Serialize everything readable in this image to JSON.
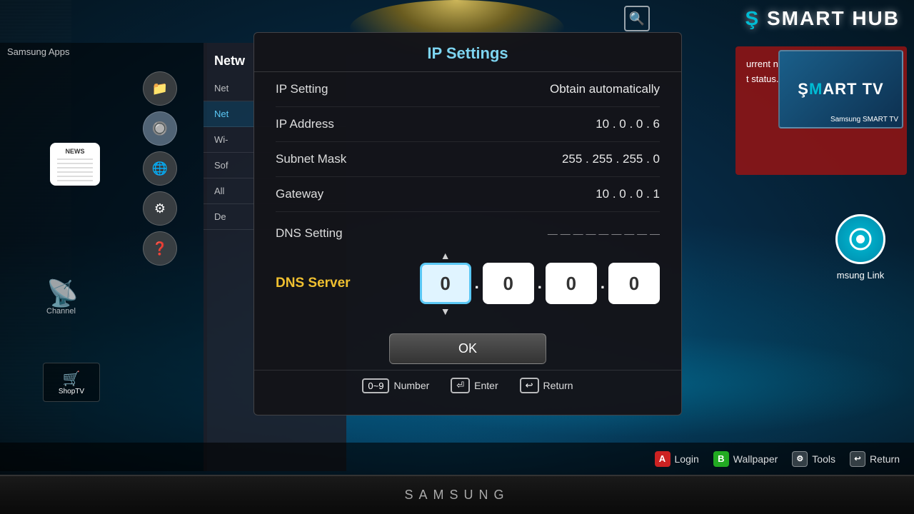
{
  "branding": {
    "smart_hub": "SMART HUB",
    "samsung": "SAMSUNG",
    "samsung_smart_tv": "Samsung SMART TV"
  },
  "network_panel": {
    "title": "Netw",
    "items": [
      {
        "label": "Net",
        "active": false
      },
      {
        "label": "Net",
        "active": true
      },
      {
        "label": "Wi-",
        "active": false
      },
      {
        "label": "Sof",
        "active": false
      },
      {
        "label": "All",
        "active": false
      },
      {
        "label": "De",
        "active": false
      }
    ]
  },
  "right_panel": {
    "text1": "urrent network",
    "text2": "t status."
  },
  "dialog": {
    "title": "IP Settings",
    "rows": [
      {
        "label": "IP Setting",
        "value": "Obtain automatically"
      },
      {
        "label": "IP Address",
        "value": "10 . 0 . 0 . 6"
      },
      {
        "label": "Subnet Mask",
        "value": "255 . 255 . 255 . 0"
      },
      {
        "label": "Gateway",
        "value": "10 . 0 . 0 . 1"
      }
    ],
    "dns_setting_label": "DNS Setting",
    "dns_server_label": "DNS Server",
    "dns_values": [
      "0",
      "0",
      "0",
      "0"
    ],
    "ok_button": "OK",
    "hints": [
      {
        "key": "0~9",
        "label": "Number"
      },
      {
        "key": "↵",
        "label": "Enter"
      },
      {
        "key": "↩",
        "label": "Return"
      }
    ]
  },
  "taskbar": {
    "items": [
      {
        "badge": "A",
        "badge_class": "badge-a",
        "label": "Login"
      },
      {
        "badge": "B",
        "badge_class": "badge-b",
        "label": "Wallpaper"
      },
      {
        "badge": "⚙",
        "badge_class": "badge-tools",
        "label": "Tools"
      },
      {
        "badge": "↩",
        "badge_class": "badge-tools",
        "label": "Return"
      }
    ]
  },
  "apps": {
    "samsung_apps": "Samsung Apps",
    "news_label": "NEWS",
    "channel_label": "Channel",
    "shoptv_label": "ShopTV",
    "samsung_link_label": "msung Link"
  },
  "side_nav_icons": [
    "📁",
    "🔘",
    "🌐",
    "⚙",
    "❓"
  ]
}
